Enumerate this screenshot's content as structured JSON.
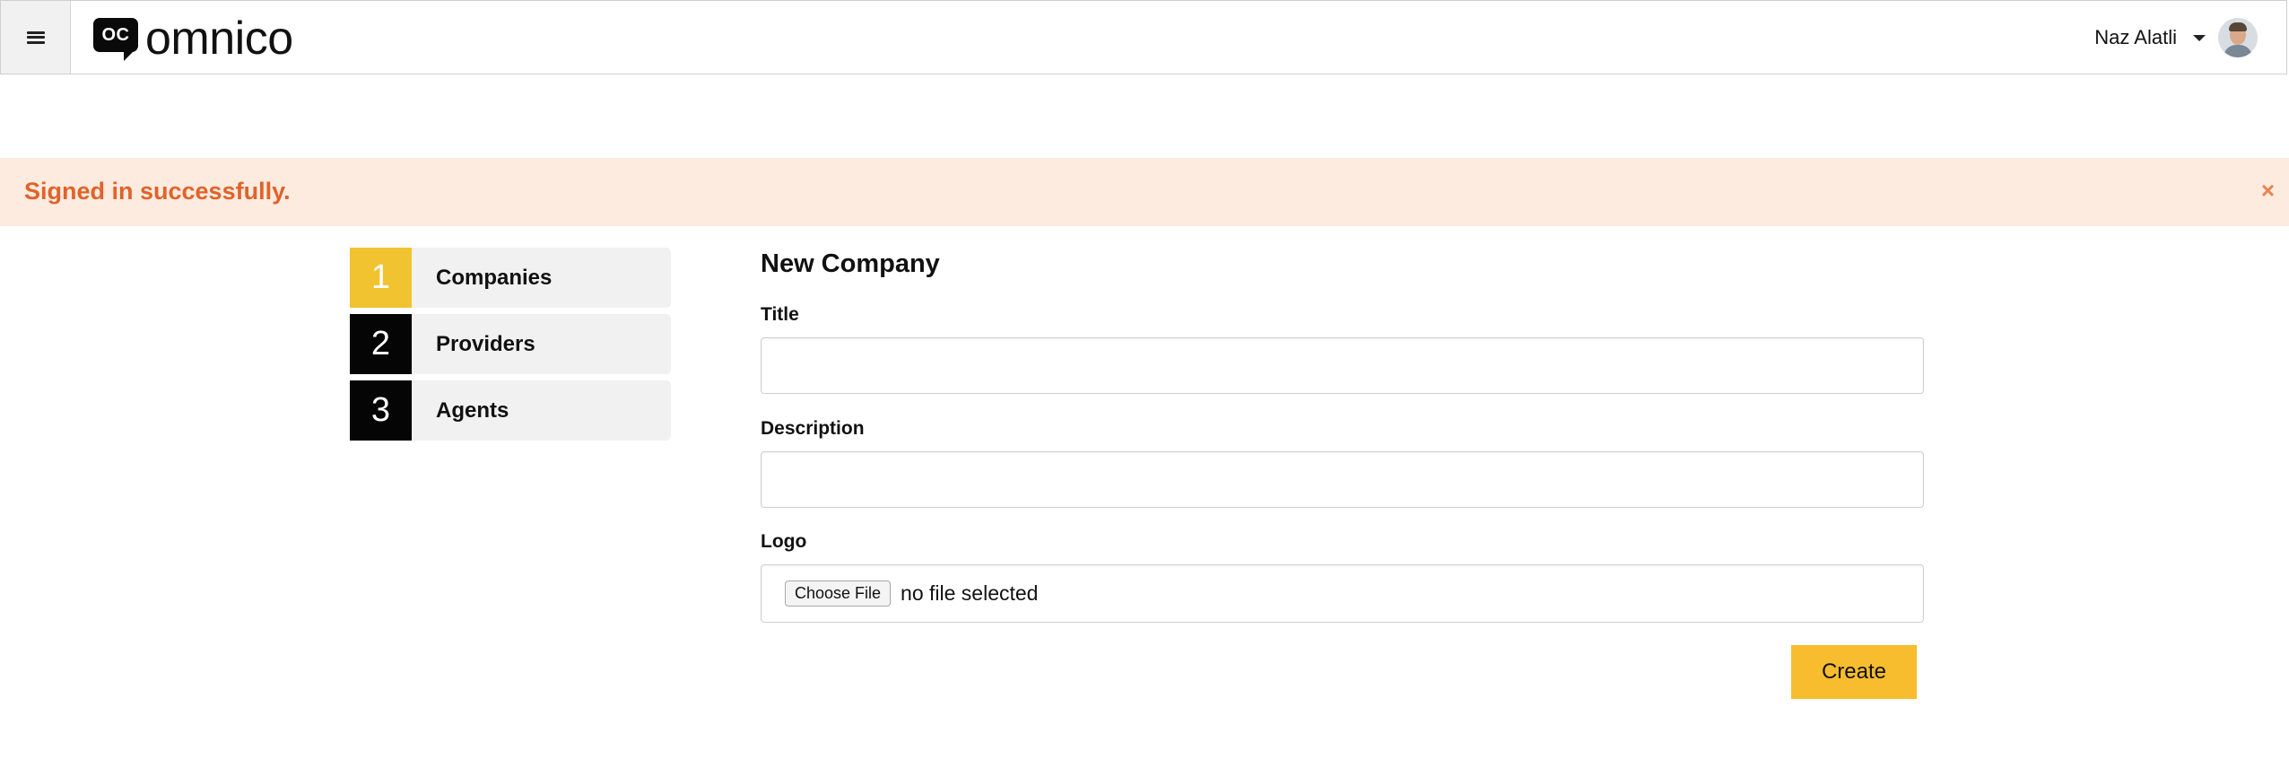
{
  "header": {
    "menu_icon": "hamburger-icon",
    "logo": {
      "mark": "OC",
      "text": "omnico"
    },
    "user": {
      "name": "Naz Alatli",
      "avatar_icon": "user-avatar"
    }
  },
  "flash": {
    "message": "Signed in successfully.",
    "close_label": "×",
    "color": "#e0632a",
    "background": "#fdebe0"
  },
  "steps": [
    {
      "number": "1",
      "label": "Companies",
      "active": true
    },
    {
      "number": "2",
      "label": "Providers",
      "active": false
    },
    {
      "number": "3",
      "label": "Agents",
      "active": false
    }
  ],
  "form": {
    "title": "New Company",
    "fields": {
      "title": {
        "label": "Title",
        "value": ""
      },
      "description": {
        "label": "Description",
        "value": ""
      },
      "logo": {
        "label": "Logo",
        "button": "Choose File",
        "status": "no file selected"
      }
    },
    "submit_label": "Create"
  },
  "colors": {
    "accent": "#f8bd2e",
    "step_active": "#f1c331",
    "step_inactive": "#050505"
  }
}
